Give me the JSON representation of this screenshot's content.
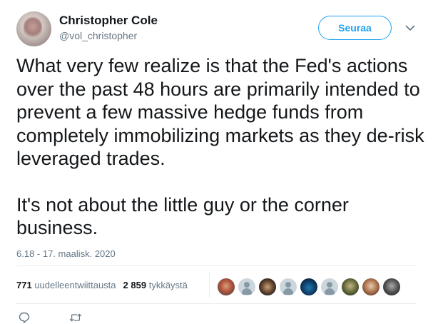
{
  "author": {
    "name": "Christopher Cole",
    "handle": "@vol_christopher"
  },
  "follow_button": {
    "label": "Seuraa"
  },
  "tweet": {
    "paragraphs": [
      "What very few realize is that the Fed's actions over the past 48 hours are primarily intended to prevent a few massive hedge funds from completely immobilizing markets as they de-risk leveraged trades.",
      "It's not about the little guy or the corner business."
    ],
    "timestamp": "6.18 - 17. maalisk. 2020"
  },
  "stats": {
    "retweets_count": "771",
    "retweets_label": "uudelleentwiittausta",
    "likes_count": "2 859",
    "likes_label": "tykkäystä"
  },
  "colors": {
    "accent": "#1da1f2",
    "text": "#14171a",
    "secondary": "#657786",
    "border": "#e6ecf0"
  },
  "icons": {
    "more": "chevron-down-icon",
    "reply": "reply-icon",
    "retweet": "retweet-icon"
  }
}
